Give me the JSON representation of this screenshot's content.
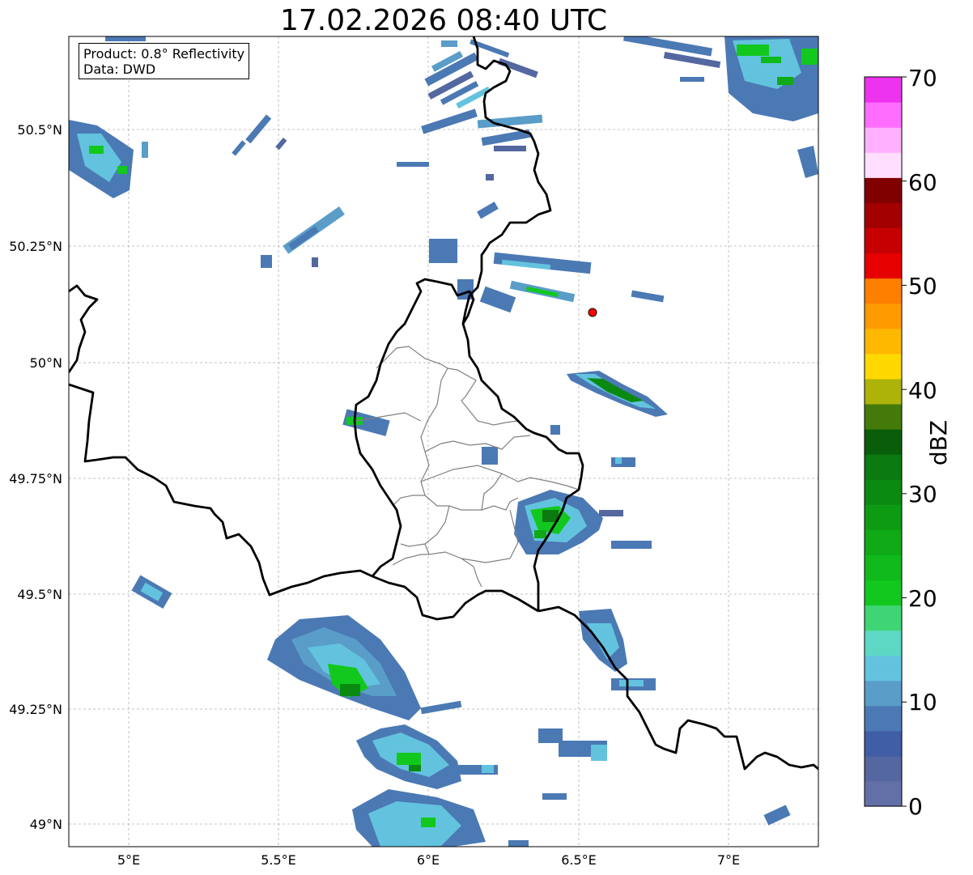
{
  "title": "17.02.2026 08:40 UTC",
  "info": {
    "product": "Product: 0.8° Reflectivity",
    "source": "Data: DWD"
  },
  "axes": {
    "x_ticks": [
      "5°E",
      "5.5°E",
      "6°E",
      "6.5°E",
      "7°E"
    ],
    "y_ticks": [
      "50.5°N",
      "50.25°N",
      "50°N",
      "49.75°N",
      "49.5°N",
      "49.25°N",
      "49°N"
    ],
    "lon_range": [
      4.8,
      7.3
    ],
    "lat_range": [
      48.95,
      50.7
    ]
  },
  "colorbar": {
    "label": "dBZ",
    "range": [
      0,
      70
    ],
    "tick_labels": [
      "0",
      "10",
      "20",
      "30",
      "40",
      "50",
      "60",
      "70"
    ],
    "colors": [
      "#6370a8",
      "#5467a0",
      "#405ea6",
      "#4b79b4",
      "#599dc8",
      "#63c3de",
      "#5cd8c4",
      "#3ed674",
      "#12c81e",
      "#10b91c",
      "#0faa16",
      "#0e9b14",
      "#0b8a12",
      "#0b7a10",
      "#0a5e0a",
      "#447a0a",
      "#aeb30a",
      "#ffd800",
      "#ffb800",
      "#ff9a00",
      "#ff7f00",
      "#e60000",
      "#c60000",
      "#a30000",
      "#800000",
      "#ffdeff",
      "#ffb1ff",
      "#ff6dff",
      "#ee33ee"
    ]
  },
  "marker": {
    "lon": 6.55,
    "lat": 50.11,
    "color": "#ff0000"
  },
  "colors": {
    "border": "#000000",
    "admin": "#808080",
    "grid": "#b0b0b0"
  }
}
